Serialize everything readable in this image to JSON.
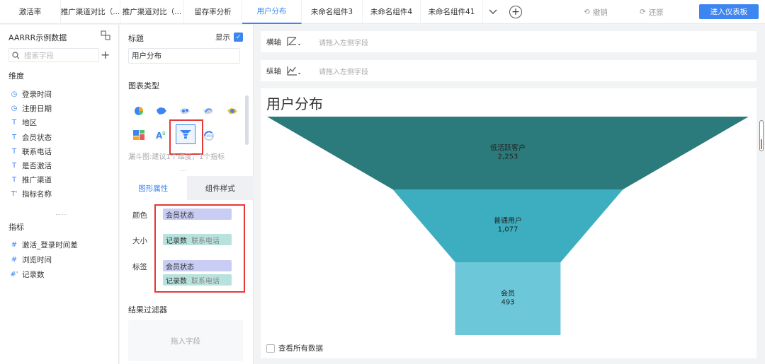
{
  "tabs": [
    {
      "label": "激活率",
      "active": false
    },
    {
      "label": "推广渠道对比（...",
      "active": false
    },
    {
      "label": "推广渠道对比（...",
      "active": false
    },
    {
      "label": "留存率分析",
      "active": false
    },
    {
      "label": "用户分布",
      "active": true
    },
    {
      "label": "未命名组件3",
      "active": false
    },
    {
      "label": "未命名组件4",
      "active": false
    },
    {
      "label": "未命名组件41",
      "active": false
    }
  ],
  "toolbar": {
    "undo": "撤销",
    "redo": "还原",
    "enter_dashboard": "进入仪表板"
  },
  "left_panel": {
    "dataset": "AARRR示例数据",
    "search_placeholder": "搜索字段",
    "dimensions_label": "维度",
    "dimensions": [
      {
        "icon": "clock",
        "label": "登录时间"
      },
      {
        "icon": "clock",
        "label": "注册日期"
      },
      {
        "icon": "text",
        "label": "地区"
      },
      {
        "icon": "text",
        "label": "会员状态"
      },
      {
        "icon": "text",
        "label": "联系电话"
      },
      {
        "icon": "text",
        "label": "是否激活"
      },
      {
        "icon": "text",
        "label": "推广渠道"
      },
      {
        "icon": "text-calc",
        "label": "指标名称"
      }
    ],
    "measures_label": "指标",
    "measures": [
      {
        "icon": "hash",
        "label": "激活_登录时间差"
      },
      {
        "icon": "hash",
        "label": "浏览时间"
      },
      {
        "icon": "hash-calc",
        "label": "记录数"
      }
    ]
  },
  "config_panel": {
    "title_label": "标题",
    "show_label": "显示",
    "title_value": "用户分布",
    "chart_type_label": "图表类型",
    "chart_type_hint": "漏斗图:建议1个维度，1个指标",
    "tab_shape": "图形属性",
    "tab_style": "组件样式",
    "color_label": "颜色",
    "color_field": "会员状态",
    "size_label": "大小",
    "size_field": "记录数",
    "size_field_sub": "联系电话",
    "tag_label": "标签",
    "tag_field_1": "会员状态",
    "tag_field_2": "记录数",
    "tag_field_2_sub": "联系电话",
    "filter_label": "结果过滤器",
    "filter_placeholder": "拖入字段"
  },
  "axes": {
    "x_label": "横轴",
    "y_label": "纵轴",
    "placeholder": "请拖入左侧字段"
  },
  "chart_data": {
    "type": "funnel",
    "title": "用户分布",
    "categories": [
      "低活跃客户",
      "普通用户",
      "会员"
    ],
    "values": [
      2253,
      1077,
      493
    ],
    "value_labels": [
      "2,253",
      "1,077",
      "493"
    ],
    "colors": [
      "#2c7b7c",
      "#3daec0",
      "#6cc7d8"
    ]
  },
  "view_all_label": "查看所有数据"
}
